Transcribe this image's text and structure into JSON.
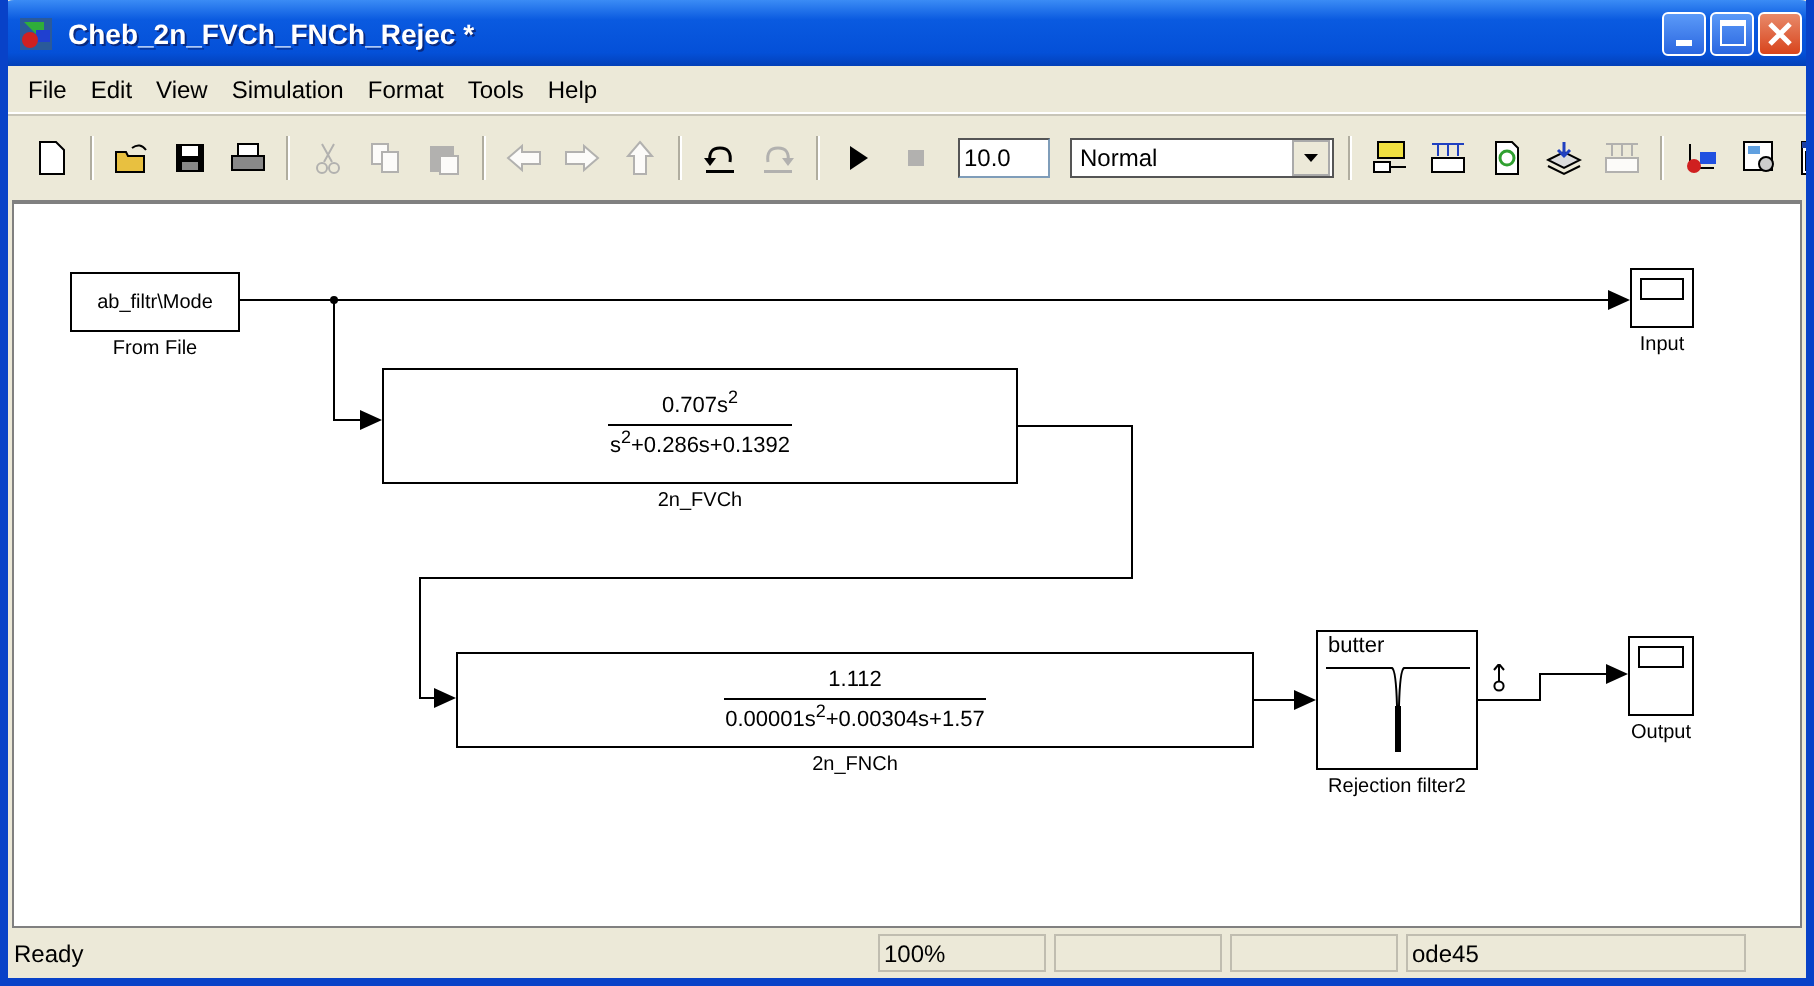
{
  "window": {
    "title": "Cheb_2n_FVCh_FNCh_Rejec *"
  },
  "menu": [
    "File",
    "Edit",
    "View",
    "Simulation",
    "Format",
    "Tools",
    "Help"
  ],
  "toolbar": {
    "items": [
      {
        "kind": "new",
        "disabled": false
      },
      {
        "kind": "separator"
      },
      {
        "kind": "open",
        "disabled": false
      },
      {
        "kind": "save",
        "disabled": false
      },
      {
        "kind": "print",
        "disabled": false
      },
      {
        "kind": "separator"
      },
      {
        "kind": "cut",
        "disabled": true
      },
      {
        "kind": "copy",
        "disabled": true
      },
      {
        "kind": "paste",
        "disabled": true
      },
      {
        "kind": "separator"
      },
      {
        "kind": "back",
        "disabled": true
      },
      {
        "kind": "forward",
        "disabled": true
      },
      {
        "kind": "up",
        "disabled": true
      },
      {
        "kind": "separator"
      },
      {
        "kind": "undo",
        "disabled": false
      },
      {
        "kind": "redo",
        "disabled": true
      },
      {
        "kind": "separator"
      },
      {
        "kind": "start",
        "disabled": false
      },
      {
        "kind": "stop",
        "disabled": true
      },
      {
        "kind": "field",
        "value": "10.0"
      },
      {
        "kind": "dropdown",
        "value": "Normal"
      },
      {
        "kind": "separator"
      },
      {
        "kind": "library",
        "disabled": false
      },
      {
        "kind": "keyboard",
        "disabled": false
      },
      {
        "kind": "refresh",
        "disabled": false
      },
      {
        "kind": "layers",
        "disabled": false
      },
      {
        "kind": "keyboard",
        "disabled": true
      },
      {
        "kind": "separator"
      },
      {
        "kind": "diagram",
        "disabled": false
      },
      {
        "kind": "zoom-page",
        "disabled": false
      },
      {
        "kind": "window",
        "disabled": false
      }
    ]
  },
  "diagram": {
    "blocks": [
      {
        "kind": "from_file",
        "text": "ab_filtr\\Mode",
        "label": "From File"
      },
      {
        "kind": "scope",
        "label": "Input"
      },
      {
        "kind": "transfer_fcn",
        "numerator": "0.707s$^{2}$",
        "denominator": "s$^{2}$+0.286s+0.1392",
        "label": "2n_FVCh"
      },
      {
        "kind": "transfer_fcn",
        "numerator": "1.112",
        "denominator": "0.00001s$^{2}$+0.00304s+1.57",
        "label": "2n_FNCh"
      },
      {
        "kind": "filter",
        "text": "butter",
        "label": "Rejection filter2"
      },
      {
        "kind": "scope",
        "label": "Output"
      }
    ]
  },
  "status_bar": {
    "message": "Ready",
    "zoom": "100%",
    "solver": "ode45"
  }
}
